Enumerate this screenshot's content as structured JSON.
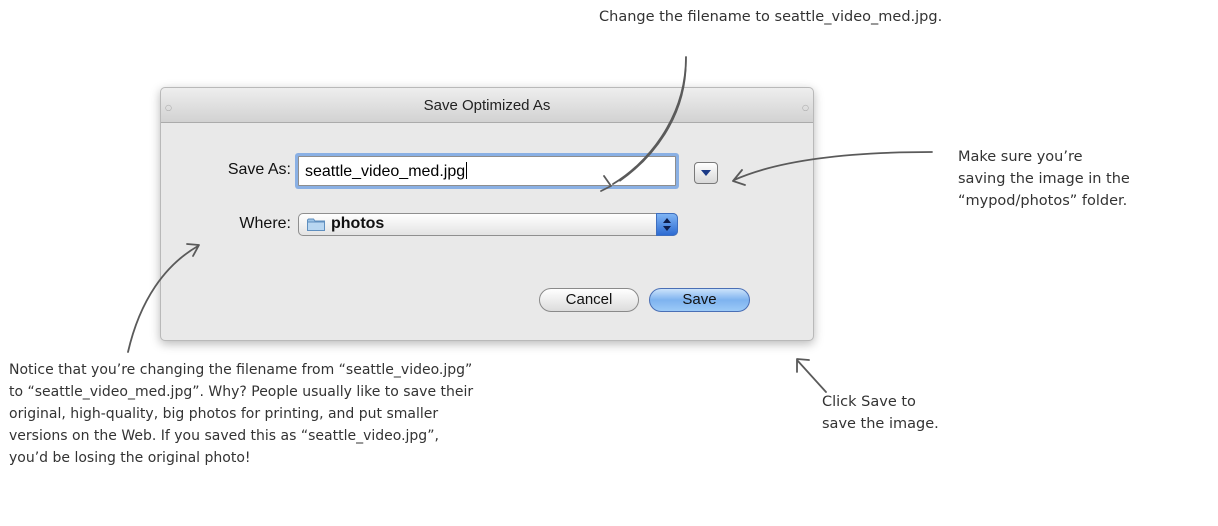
{
  "dialog": {
    "title": "Save Optimized As",
    "save_as_label": "Save As:",
    "filename_value": "seattle_video_med.jpg",
    "where_label": "Where:",
    "where_value": "photos",
    "cancel_label": "Cancel",
    "save_label": "Save"
  },
  "icons": {
    "disclosure": "chevron-down-icon",
    "folder": "folder-icon",
    "popup_stepper": "up-down-arrows-icon"
  },
  "colors": {
    "default_button": "#8fc0f4",
    "focus_ring": "#8ab0e4",
    "dialog_bg": "#e9e9e9"
  },
  "annotations": {
    "filename_tip": "Change the filename to seattle_video_med.jpg.",
    "folder_tip": [
      "Make sure you’re",
      "saving the image in the",
      "“mypod/photos” folder."
    ],
    "save_tip": [
      "Click Save to",
      "save the image."
    ],
    "notice": [
      "Notice that you’re changing the filename from “seattle_video.jpg”",
      "to “seattle_video_med.jpg”. Why? People usually like to save their",
      "original, high-quality, big photos for printing, and put smaller",
      "versions on the Web. If you saved this as “seattle_video.jpg”,",
      "you’d be losing the original photo!"
    ]
  }
}
